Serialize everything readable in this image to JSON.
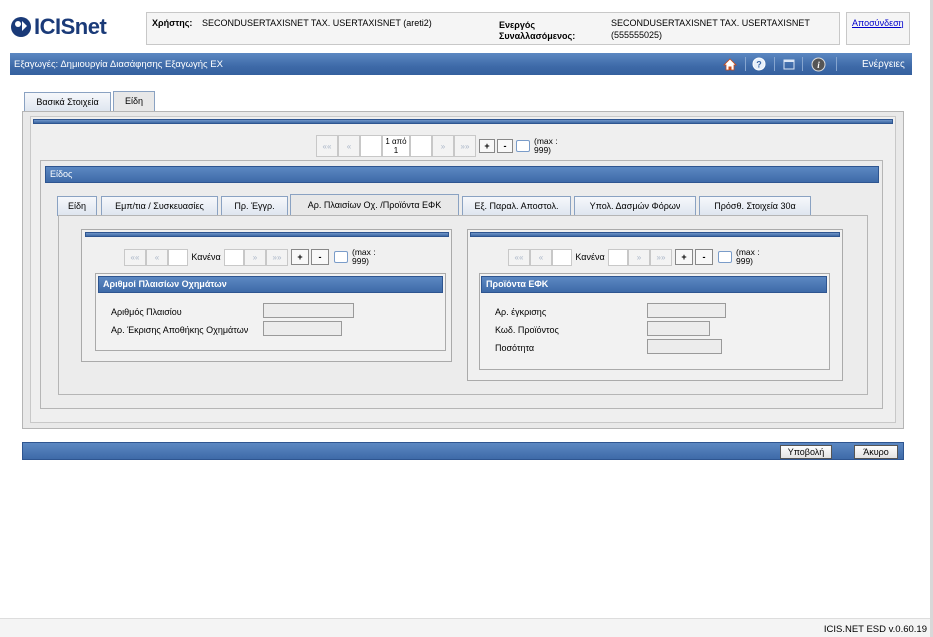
{
  "header": {
    "logo_text": "ICISnet",
    "user_label": "Χρήστης:",
    "user_value": "SECONDUSERTAXISNET TAX. USERTAXISNET (areti2)",
    "acting_label_line1": "Ενεργός",
    "acting_label_line2": "Συναλλασόμενος:",
    "acting_value_line1": "SECONDUSERTAXISNET TAX. USERTAXISNET",
    "acting_value_line2": "(555555025)",
    "logout": "Αποσύνδεση"
  },
  "titlebar": {
    "title": "Εξαγωγές: Δημιουργία Διασάφησης Εξαγωγής ΕΧ",
    "actions": "Ενέργειες"
  },
  "main_tabs": [
    "Βασικά Στοιχεία",
    "Είδη"
  ],
  "outer_pager": {
    "first": "««",
    "prev": "«",
    "current": "1 από",
    "total": "1",
    "next": "»",
    "last": "»»",
    "add": "+",
    "remove": "-",
    "max_line1": "(max :",
    "max_line2": "999)"
  },
  "item_section": {
    "title": "Είδος"
  },
  "item_tabs": [
    "Είδη",
    "Εμπ/τια / Συσκευασίες",
    "Πρ. Έγγρ.",
    "Αρ. Πλαισίων Οχ. /Προϊόντα ΕΦΚ",
    "Εξ. Παραλ. Αποστολ.",
    "Υπολ. Δασμών Φόρων",
    "Πρόσθ. Στοιχεία 30α"
  ],
  "left_pager": {
    "first": "««",
    "prev": "«",
    "current": "Κανένα",
    "next": "»",
    "last": "»»",
    "add": "+",
    "remove": "-",
    "max_line1": "(max :",
    "max_line2": "999)"
  },
  "right_pager": {
    "first": "««",
    "prev": "«",
    "current": "Κανένα",
    "next": "»",
    "last": "»»",
    "add": "+",
    "remove": "-",
    "max_line1": "(max :",
    "max_line2": "999)"
  },
  "chassis_section": {
    "title": "Αριθμοί Πλαισίων Οχημάτων",
    "fields": [
      {
        "label": "Αριθμός Πλαισίου",
        "value": ""
      },
      {
        "label": "Αρ. Έκρισης Αποθήκης Οχημάτων",
        "value": ""
      }
    ]
  },
  "efk_section": {
    "title": "Προϊόντα ΕΦΚ",
    "fields": [
      {
        "label": "Αρ. έγκρισης",
        "value": ""
      },
      {
        "label": "Κωδ. Προϊόντος",
        "value": ""
      },
      {
        "label": "Ποσότητα",
        "value": ""
      }
    ]
  },
  "buttons": {
    "submit": "Υποβολή",
    "cancel": "Άκυρο"
  },
  "footer": {
    "version": "ICIS.NET ESD v.0.60.19"
  },
  "colors": {
    "accent_blue": "#3e6aa8",
    "brand": "#1a3a78",
    "link": "#0000cc"
  },
  "icons": [
    "home-icon",
    "help-icon",
    "window-icon",
    "info-icon"
  ]
}
